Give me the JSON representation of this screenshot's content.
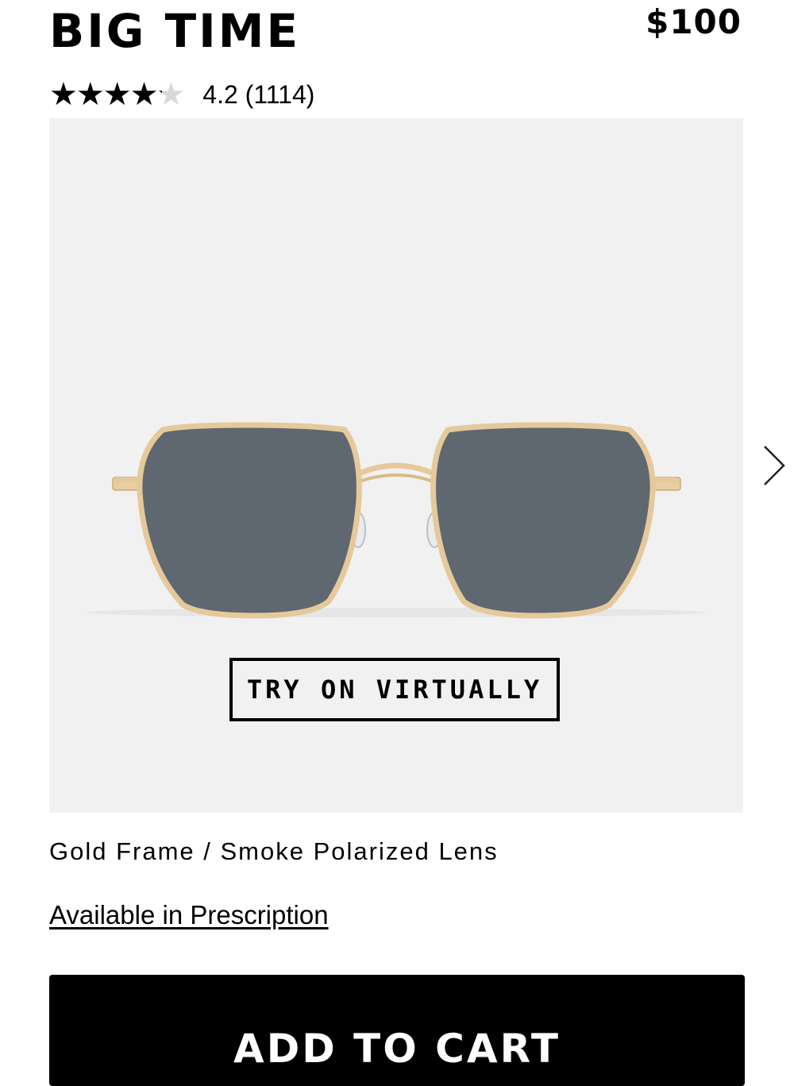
{
  "product": {
    "name": "BIG TIME",
    "price": "$100",
    "rating": {
      "value": 4.2,
      "max": 5,
      "label": "4.2 (1114)"
    },
    "image_alt": "gold-frame-sunglasses",
    "variant": "Gold Frame / Smoke Polarized Lens",
    "prescription_link": "Available in Prescription"
  },
  "gallery": {
    "try_on_label": "TRY ON VIRTUALLY",
    "next_icon": "chevron-right-icon"
  },
  "cart": {
    "add_label": "ADD TO CART"
  },
  "colors": {
    "panel_bg": "#f1f1f1",
    "frame_gold": "#e6c99a",
    "lens_smoke": "#5f6770",
    "button_bg": "#000000"
  }
}
